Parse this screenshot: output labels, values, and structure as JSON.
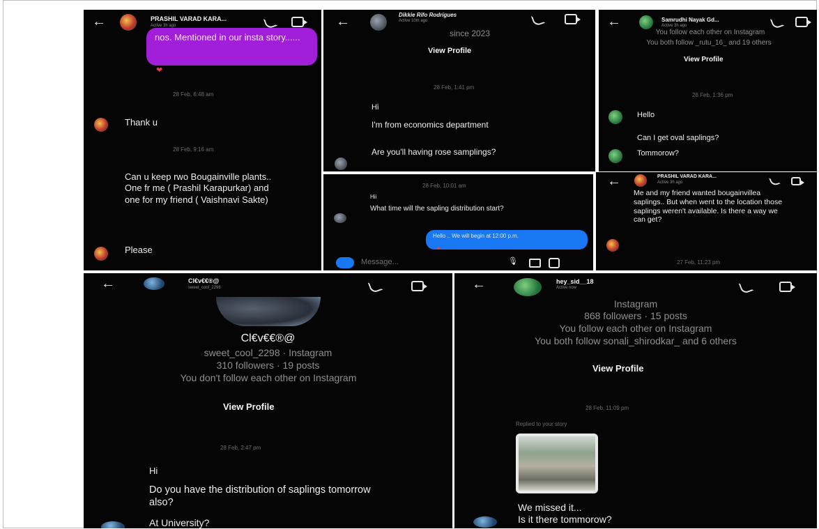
{
  "panel1": {
    "contact_name": "PRASHIL VARAD KARA...",
    "contact_status": "Active 3h ago",
    "bubble_text": "nos. Mentioned in our insta story......",
    "ts1": "28 Feb, 6:48 am",
    "msg1": "Thank u",
    "ts2": "28 Feb, 9:16 am",
    "msg2": "Can u keep rwo Bougainville plants.. One fr me ( Prashil Karapurkar) and one for my friend ( Vaishnavi Sakte)",
    "msg3": "Please"
  },
  "panel2": {
    "contact_name": "Dikkie Rifo Rodrigues",
    "contact_status": "Active 10m ago",
    "since": "since 2023",
    "view_profile": "View Profile",
    "ts": "28 Feb, 1:41 pm",
    "msg1": "Hi",
    "msg2": "I'm from economics department",
    "msg3": "Are you'll having rose samplings?"
  },
  "panel3": {
    "contact_name": "Samrudhi Nayak Gd...",
    "contact_status": "Active 3h ago",
    "line1": "You follow each other on Instagram",
    "line2": "You both follow _rutu_16_ and 19 others",
    "view_profile": "View Profile",
    "ts": "28 Feb, 1:36 pm",
    "msg1": "Hello",
    "msg2": "Can I get oval saplings?",
    "msg3": "Tommorow?"
  },
  "panel4": {
    "ts": "28 Feb, 10:01 am",
    "msg1": "Hii",
    "msg2": "What time will the sapling distribution start?",
    "reply": "Hello .. We will begin at 12:00 p.m.",
    "composer_placeholder": "Message..."
  },
  "panel5": {
    "contact_name": "PRASHIL VARAD KARA...",
    "contact_status": "Active 3h ago",
    "msg": "Me and my friend wanted bougainvillea saplings.. But when went to the location those saplings weren't available. Is there a way we can get?",
    "ts": "27 Feb, 11:23 pm"
  },
  "panel6": {
    "contact_name": "Cl€v€€®@",
    "contact_status": "sweet_cool_2298",
    "display_name": "Cl€v€€®@",
    "handle_line": "sweet_cool_2298 · Instagram",
    "stats": "310 followers · 19 posts",
    "follow_line": "You don't follow each other on Instagram",
    "view_profile": "View Profile",
    "ts": "28 Feb, 2:47 pm",
    "msg1": "Hi",
    "msg2": "Do you have the distribution of saplings tomorrow also?",
    "msg3": "At University?"
  },
  "panel7": {
    "contact_name": "hey_sid__18",
    "contact_status": "Active now",
    "line1": "Instagram",
    "line2": "868 followers · 15 posts",
    "line3": "You follow each other on Instagram",
    "line4": "You both follow sonali_shirodkar_ and 6 others",
    "view_profile": "View Profile",
    "ts": "28 Feb, 11:09 pm",
    "replied": "Replied to your story",
    "msg1": "We missed it...",
    "msg2": "Is it there tommorow?"
  },
  "icons": [
    "back-arrow-icon",
    "phone-icon",
    "video-camera-icon",
    "heart-reaction-icon",
    "camera-icon",
    "microphone-icon",
    "gallery-icon",
    "sticker-icon"
  ],
  "colors": {
    "background": "#050505",
    "purple_bubble": "#a11fd8",
    "blue_bubble": "#1877f2",
    "heart": "#e53e4d"
  }
}
